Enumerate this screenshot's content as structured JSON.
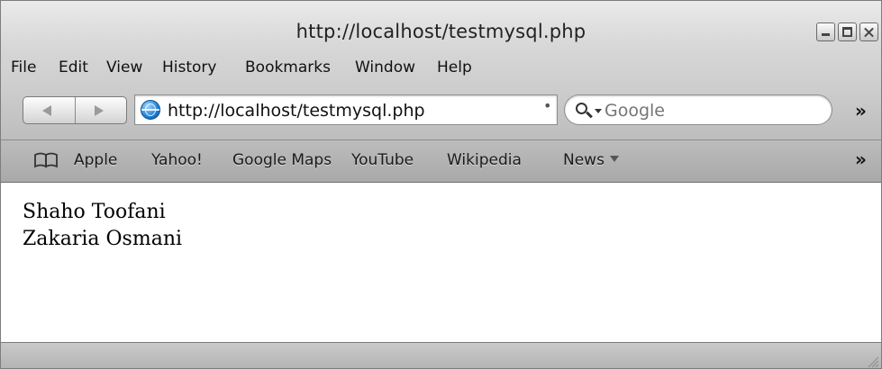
{
  "window": {
    "title": "http://localhost/testmysql.php"
  },
  "menu": {
    "items": [
      "File",
      "Edit",
      "View",
      "History",
      "Bookmarks",
      "Window",
      "Help"
    ]
  },
  "toolbar": {
    "url": "http://localhost/testmysql.php",
    "search_placeholder": "Google",
    "overflow": "»"
  },
  "bookmarks": {
    "items": [
      "Apple",
      "Yahoo!",
      "Google Maps",
      "YouTube",
      "Wikipedia",
      "News"
    ],
    "overflow": "»"
  },
  "content": {
    "lines": [
      "Shaho Toofani",
      "Zakaria Osmani"
    ]
  },
  "icons": {
    "back": "back-arrow-icon",
    "forward": "forward-arrow-icon",
    "site": "globe-icon",
    "search": "magnifier-icon",
    "bookmarks": "open-book-icon",
    "resize": "resize-grip-icon"
  }
}
